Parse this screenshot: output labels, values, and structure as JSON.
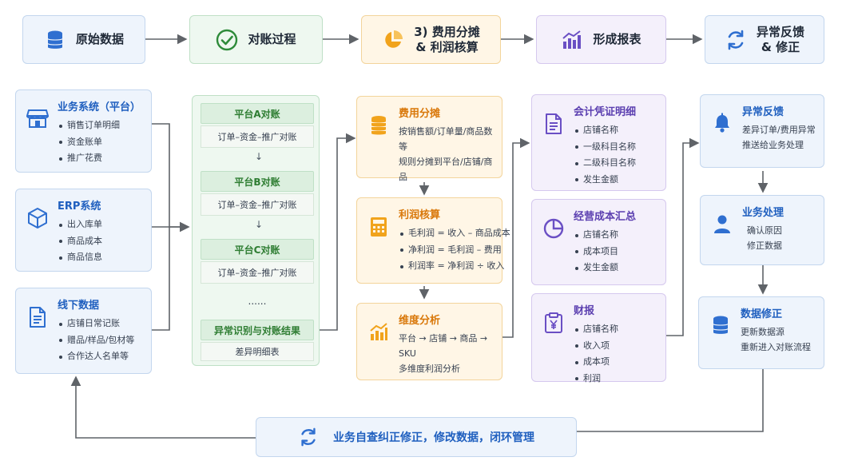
{
  "stages": [
    {
      "label": "原始数据",
      "icon": "database-icon"
    },
    {
      "label": "对账过程",
      "icon": "check-circle-icon"
    },
    {
      "label": "3) 费用分摊\n& 利润核算",
      "icon": "pie-chart-icon"
    },
    {
      "label": "形成报表",
      "icon": "bar-chart-icon"
    },
    {
      "label": "异常反馈\n& 修正",
      "icon": "refresh-icon"
    }
  ],
  "sources": [
    {
      "title": "业务系统（平台）",
      "icon": "store-icon",
      "items": [
        "销售订单明细",
        "资金账单",
        "推广花费"
      ]
    },
    {
      "title": "ERP系统",
      "icon": "cube-icon",
      "items": [
        "出入库单",
        "商品成本",
        "商品信息"
      ]
    },
    {
      "title": "线下数据",
      "icon": "document-icon",
      "items": [
        "店铺日常记账",
        "赠品/样品/包材等",
        "合作达人名单等"
      ]
    }
  ],
  "reconcile": {
    "steps": [
      {
        "head": "平台A对账",
        "sub": "订单–资金–推广对账"
      },
      {
        "head": "平台B对账",
        "sub": "订单–资金–推广对账"
      },
      {
        "head": "平台C对账",
        "sub": "订单–资金–推广对账"
      }
    ],
    "ellipsis": "......",
    "result": "异常识别与对账结果",
    "result_sub": "差异明细表"
  },
  "allocation": {
    "cost": {
      "title": "费用分摊",
      "icon": "coins-icon",
      "lines": [
        "按销售额/订单量/商品数等",
        "规则分摊到平台/店铺/商品"
      ]
    },
    "profit": {
      "title": "利润核算",
      "icon": "calculator-icon",
      "items": [
        "毛利润 = 收入 – 商品成本",
        "净利润 = 毛利润 – 费用",
        "利润率 = 净利润 ÷ 收入"
      ]
    },
    "dimension": {
      "title": "维度分析",
      "icon": "growth-chart-icon",
      "lines": [
        "平台 → 店铺 → 商品 → SKU",
        "多维度利润分析"
      ]
    }
  },
  "reports": [
    {
      "title": "会计凭证明细",
      "icon": "voucher-icon",
      "items": [
        "店铺名称",
        "一级科目名称",
        "二级科目名称",
        "发生金额"
      ]
    },
    {
      "title": "经营成本汇总",
      "icon": "pie-chart-icon",
      "items": [
        "店铺名称",
        "成本项目",
        "发生金额"
      ]
    },
    {
      "title": "财报",
      "icon": "clipboard-yen-icon",
      "items": [
        "店铺名称",
        "收入项",
        "成本项",
        "利润"
      ]
    }
  ],
  "feedback": [
    {
      "title": "异常反馈",
      "icon": "bell-icon",
      "lines": [
        "差异订单/费用异常",
        "推送给业务处理"
      ]
    },
    {
      "title": "业务处理",
      "icon": "user-icon",
      "lines": [
        "确认原因",
        "修正数据"
      ]
    },
    {
      "title": "数据修正",
      "icon": "database-icon",
      "lines": [
        "更新数据源",
        "重新进入对账流程"
      ]
    }
  ],
  "loop": {
    "label": "业务自查纠正修正，修改数据，闭环管理",
    "icon": "refresh-icon"
  },
  "colors": {
    "blue": "#1f5fbf",
    "green": "#2e7d32",
    "orange": "#d9780a",
    "purple": "#5b3fb0",
    "arrow": "#5f6368"
  }
}
